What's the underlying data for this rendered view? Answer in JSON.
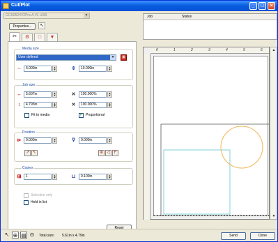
{
  "window": {
    "title": "Cut/Plot"
  },
  "device": {
    "name": "GCS0524V2Pre.A VL  USB"
  },
  "toolbar": {
    "properties_label": "Properties..."
  },
  "tabs": [
    {
      "icon": "cut-settings-icon",
      "glyph": "✂"
    },
    {
      "icon": "tool-icon",
      "glyph": "⚙"
    },
    {
      "icon": "frame-icon",
      "glyph": "□"
    },
    {
      "icon": "pin-icon",
      "glyph": "▼"
    }
  ],
  "media_size": {
    "label": "Media size",
    "selected": "User defined",
    "width": "6.000in",
    "length": "10.000in"
  },
  "job_size": {
    "label": "Job size",
    "width": "5.607in",
    "width_pct": "100.000%",
    "height": "4.793in",
    "height_pct": "100.000%",
    "fit_to_media_label": "Fit to media",
    "fit_to_media_checked": false,
    "proportional_label": "Proportional",
    "proportional_checked": true
  },
  "position": {
    "label": "Position",
    "x": "0.000in",
    "y": "0.000in"
  },
  "copies": {
    "label": "Copies",
    "count": "1",
    "spacing": "0.100in"
  },
  "options": {
    "selection_only_label": "Selection only",
    "hold_in_list_label": "Hold in list",
    "hold_in_list_checked": false
  },
  "reset_label": "Reset",
  "queue": {
    "col_job": "Job",
    "col_status": "Status"
  },
  "ruler": {
    "top": [
      "0",
      "1",
      "2",
      "3",
      "4",
      "5",
      "6"
    ]
  },
  "status": {
    "total_size_label": "Total size:",
    "total_size_value": "5.61in x 4.79in"
  },
  "buttons": {
    "send": "Send",
    "done": "Done"
  },
  "colors": {
    "title_bar": "#0a5ee0",
    "circle": "#f2b556",
    "rect": "#7fd0d8"
  }
}
